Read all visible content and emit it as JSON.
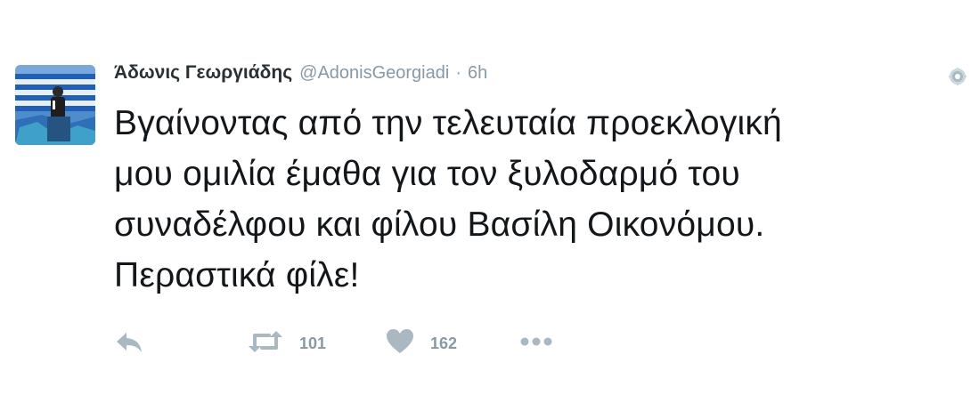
{
  "tweet": {
    "author_name": "Άδωνις Γεωργιάδης",
    "handle": "@AdonisGeorgiadi",
    "separator": "·",
    "time": "6h",
    "text_lines": [
      "Βγαίνοντας από την τελευταία προεκλογική",
      "μου ομιλία έμαθα για τον ξυλοδαρμό του",
      "συναδέλφου και φίλου Βασίλη Οικονόμου.",
      "Περαστικά φίλε!"
    ]
  },
  "actions": {
    "retweet_count": "101",
    "like_count": "162"
  },
  "icons": {
    "reply": "reply-icon",
    "retweet": "retweet-icon",
    "like": "heart-icon",
    "more": "more-icon",
    "options": "gear-icon"
  },
  "colors": {
    "muted": "#8899a6",
    "text": "#14171a"
  }
}
